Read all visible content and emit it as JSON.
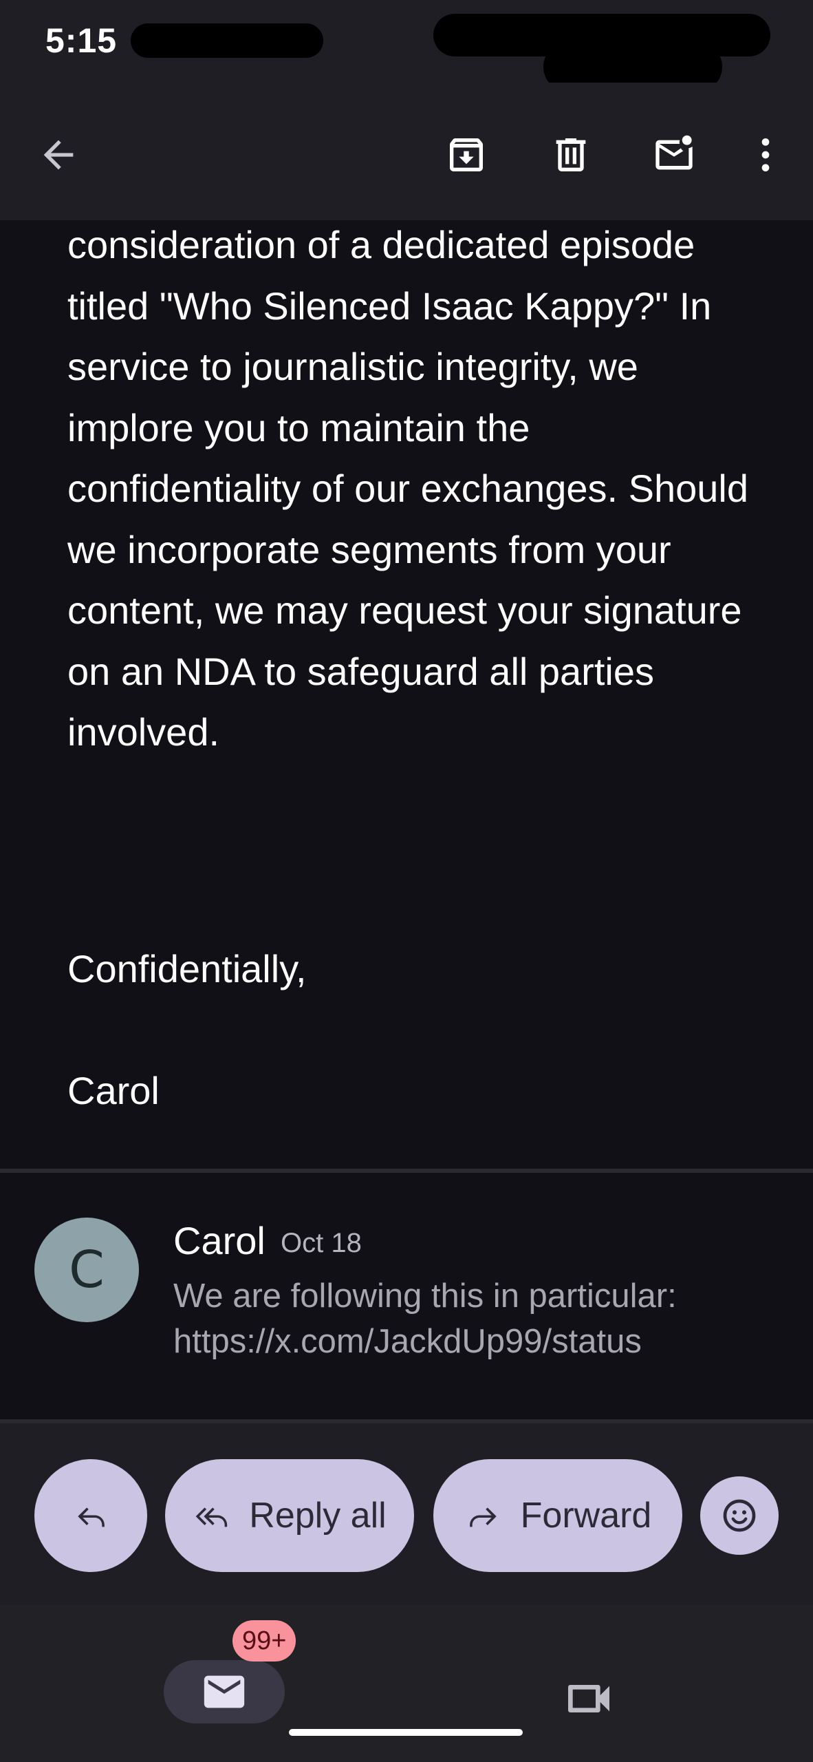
{
  "status_bar": {
    "time": "5:15"
  },
  "app_bar": {
    "icons": [
      "back-arrow-icon",
      "archive-icon",
      "delete-icon",
      "mark-unread-icon",
      "more-vertical-icon"
    ]
  },
  "email": {
    "body": "consideration of a dedicated episode titled \"Who Silenced Isaac Kappy?\" In service to journalistic integrity, we implore you to maintain the confidentiality of our exchanges. Should we incorporate segments from your content, we may request your signature on an NDA to safeguard all parties involved.",
    "closing": "Confidentially,",
    "signature": "Carol"
  },
  "collapsed_message": {
    "avatar_letter": "C",
    "sender": "Carol",
    "date": "Oct 18",
    "snippet_line1": "We are following this in particular:",
    "snippet_line2": "https://x.com/JackdUp99/status"
  },
  "actions": {
    "reply_all_label": "Reply all",
    "forward_label": "Forward"
  },
  "bottom_nav": {
    "mail_badge": "99+"
  },
  "colors": {
    "background": "#111017",
    "bar": "#1f1e24",
    "pill": "#cbc5e3",
    "avatar": "#8ea3a9",
    "badge": "#f8929b"
  }
}
